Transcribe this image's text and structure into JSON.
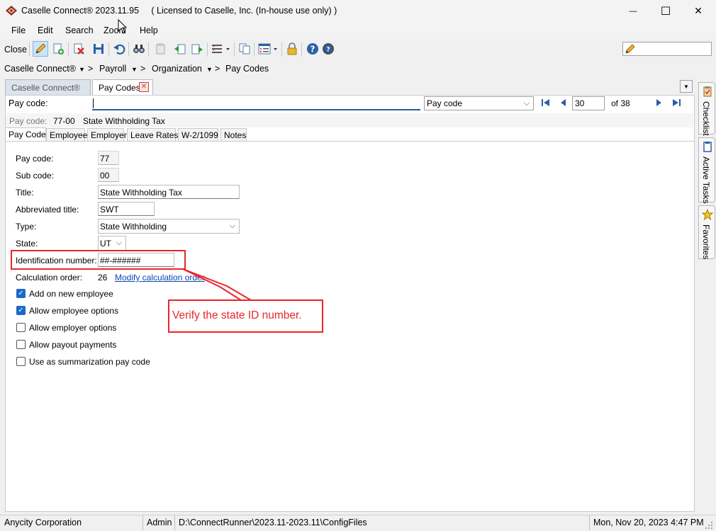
{
  "window": {
    "title": "Caselle Connect® 2023.11.95     ( Licensed to Caselle, Inc. (In-house use only) )",
    "minimize_glyph": "—",
    "maximize_glyph": "☐",
    "close_glyph": "✕"
  },
  "menu": [
    "File",
    "Edit",
    "Search",
    "Zoom",
    "Help"
  ],
  "toolbar": {
    "close_label": "Close",
    "icons": [
      "edit-icon",
      "add-record-icon",
      "delete-icon",
      "save-icon",
      "undo-icon",
      "find-icon",
      "report-icon",
      "import-icon",
      "export-icon",
      "list-options-icon",
      "copy-icon",
      "layout-icon",
      "lock-icon",
      "help-icon",
      "help-topics-icon"
    ]
  },
  "breadcrumb": [
    "Caselle Connect®",
    "Payroll",
    "Organization",
    "Pay Codes"
  ],
  "doc_tabs": {
    "caselle": "Caselle Connect®",
    "paycodes": "Pay Codes",
    "close_glyph": "✕"
  },
  "search": {
    "label": "Pay code:",
    "value": "",
    "field": "Pay code",
    "record": "30",
    "of_label": "of 38"
  },
  "info": {
    "label": "Pay code:",
    "code": "77-00",
    "title": "State Withholding Tax"
  },
  "subtabs": [
    "Pay Code",
    "Employee",
    "Employer",
    "Leave Rates",
    "W-2/1099",
    "Notes"
  ],
  "form": {
    "pay_code_label": "Pay code:",
    "pay_code": "77",
    "sub_code_label": "Sub code:",
    "sub_code": "00",
    "title_label": "Title:",
    "title": "State Withholding Tax",
    "abbrev_label": "Abbreviated title:",
    "abbrev": "SWT",
    "type_label": "Type:",
    "type": "State Withholding",
    "state_label": "State:",
    "state": "UT",
    "id_label": "Identification number:",
    "id_number": "##-######",
    "calc_label": "Calculation order:",
    "calc_order": "26",
    "modify_link": "Modify calculation order",
    "checkboxes": [
      {
        "label": "Add on new employee",
        "checked": true
      },
      {
        "label": "Allow employee options",
        "checked": true
      },
      {
        "label": "Allow employer options",
        "checked": false
      },
      {
        "label": "Allow payout payments",
        "checked": false
      },
      {
        "label": "Use as summarization pay code",
        "checked": false
      }
    ]
  },
  "callout": "Verify the state ID number.",
  "side_tabs": [
    "Checklist",
    "Active Tasks",
    "Favorites"
  ],
  "status": {
    "org": "Anycity Corporation",
    "user": "Admin",
    "path": "D:\\ConnectRunner\\2023.11-2023.11\\ConfigFiles",
    "datetime": "Mon, Nov 20, 2023 4:47 PM"
  },
  "colors": {
    "accent": "#1b6ac9",
    "annotation_red": "#e8262b",
    "link": "#0b47b0"
  }
}
